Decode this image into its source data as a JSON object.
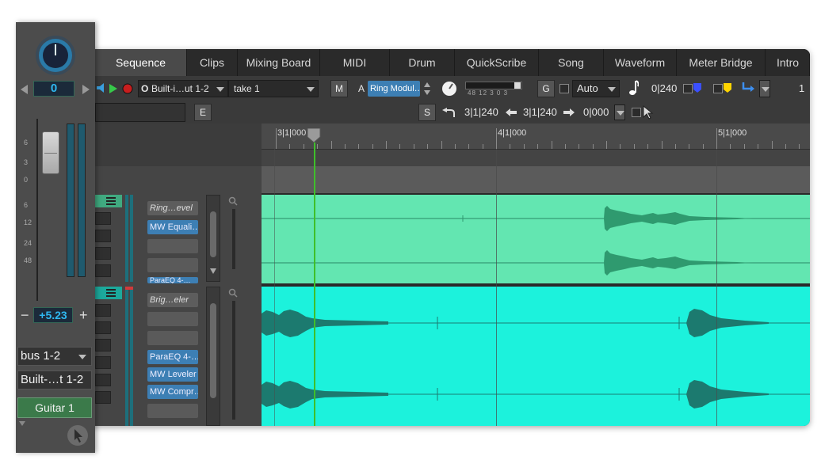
{
  "tabs": [
    "Sequence",
    "Clips",
    "Mixing Board",
    "MIDI",
    "Drum",
    "QuickScribe",
    "Song",
    "Waveform",
    "Meter Bridge",
    "Intro"
  ],
  "active_tab": "Sequence",
  "toolbar": {
    "input": "Built-i…ut 1-2",
    "take": "take 1",
    "m_label": "M",
    "a_label": "A",
    "plugin": "Ring Modul…",
    "meter_scale": "48  12  3 0 3",
    "g_label": "G",
    "automation": "Auto",
    "counter1": "0|240",
    "number": "1",
    "e_label": "E",
    "s_label": "S",
    "loc_start": "3|1|240",
    "loc_end": "3|1|240",
    "loc_len": "0|000"
  },
  "ruler": {
    "markers": [
      "3|1|000",
      "4|1|000",
      "5|1|000"
    ]
  },
  "tracks": [
    {
      "inserts_header": "Ring…evel",
      "inserts": [
        "MW Equali…",
        "",
        ""
      ],
      "partial": "ParaEQ 4-…",
      "color": "#63e6b1"
    },
    {
      "inserts_header": "Brig…eler",
      "inserts": [
        "",
        "",
        "ParaEQ 4-…",
        "MW Leveler",
        "MW Compr…"
      ],
      "color": "#1cf2dc"
    }
  ],
  "channel_strip": {
    "pan_value": "0",
    "meter_scale": [
      "6",
      "3",
      "0",
      "6",
      "12",
      "24",
      "48"
    ],
    "volume": "+5.23",
    "minus": "−",
    "plus": "+",
    "output": "bus 1-2",
    "input": "Built-…t 1-2",
    "track_name": "Guitar 1"
  }
}
